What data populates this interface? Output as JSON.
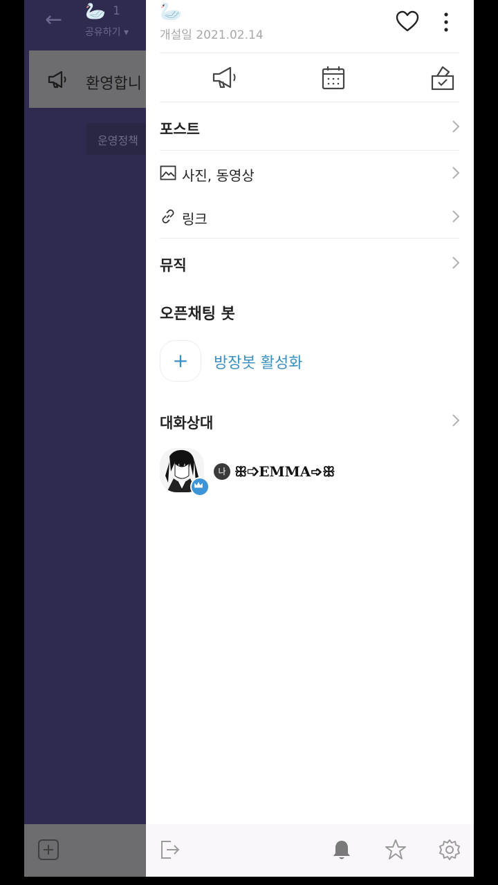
{
  "background": {
    "header": {
      "count": "1",
      "share_label": "공유하기 ▾"
    },
    "notice_text": "환영합니",
    "policy_text": "운영정책"
  },
  "drawer": {
    "established": "개설일 2021.02.14",
    "menu": {
      "post": "포스트",
      "media": "사진, 동영상",
      "link": "링크",
      "music": "뮤직"
    },
    "bot_section": {
      "title": "오픈채팅 봇",
      "add_label": "방장봇 활성화"
    },
    "members_section": {
      "title": "대화상대",
      "members": [
        {
          "badge": "나",
          "name": "ꕥ➩EMMA➩ꕥ"
        }
      ]
    }
  },
  "colors": {
    "chat_bg": "#2e2b4f",
    "accent_blue": "#3a90c0",
    "host_badge": "#3d95d8"
  },
  "icons": [
    "back-arrow-icon",
    "swan-icon",
    "megaphone-icon",
    "heart-icon",
    "more-vertical-icon",
    "calendar-icon",
    "vote-box-icon",
    "image-icon",
    "link-icon",
    "chevron-right-icon",
    "plus-icon",
    "crown-icon",
    "exit-icon",
    "bell-icon",
    "star-icon",
    "gear-icon"
  ]
}
